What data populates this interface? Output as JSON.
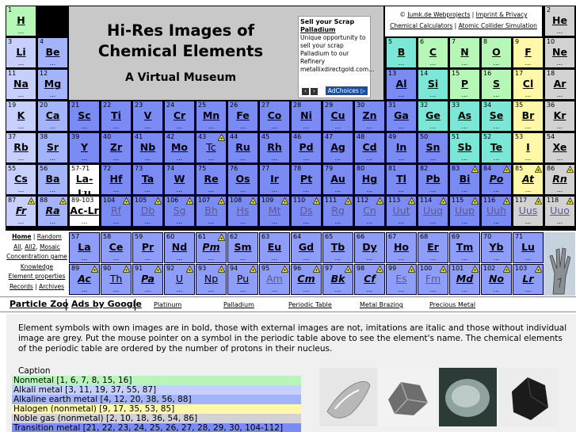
{
  "site": {
    "title_line1": "Hi-Res Images of",
    "title_line2": "Chemical Elements",
    "subtitle": "A Virtual Museum",
    "links": {
      "copyright": "©",
      "author": "Jumk.de Webprojects",
      "imprint": "Imprint & Privacy",
      "calculators": "Chemical Calculators",
      "collider": "Atomic Collider Simulation"
    }
  },
  "ad": {
    "heading": "Sell your Scrap",
    "link": "Palladium",
    "body": "Unique opportunity to sell your scrap Palladium to our Refinery",
    "url": "metallixdirectgold.com...",
    "adchoices": "AdChoices"
  },
  "menu": {
    "items": [
      "Home",
      "Random",
      "All",
      "All2",
      "Mosaic",
      "Concentration game",
      "Knowledge",
      "Element properties",
      "Records",
      "Archives"
    ]
  },
  "bottom_bar": {
    "particle_zoo": "Particle Zoo",
    "ads_by_google": "Ads by Google",
    "links": [
      "Platinum",
      "Palladium",
      "Periodic Table",
      "Metal Brazing",
      "Precious Metal"
    ]
  },
  "intro_text": "Element symbols with own images are in bold, those with external images are not, imitations are italic and those without individual image are grey. Put the mouse pointer on a symbol in the periodic table above to see the element's name. The chemical elements of the periodic table are ordered by the number of protons in their nucleus.",
  "caption_label": "Caption",
  "legend": [
    {
      "label": "Nonmetal [1, 6, 7, 8, 15, 16]",
      "color": "#b6f6b6"
    },
    {
      "label": "Alkali metal [3, 11, 19, 37, 55, 87]",
      "color": "#c7cffd"
    },
    {
      "label": "Alkaline earth metal [4, 12, 20, 38, 56, 88]",
      "color": "#a4b4fa"
    },
    {
      "label": "Halogen (nonmetal) [9, 17, 35, 53, 85]",
      "color": "#fff8a8"
    },
    {
      "label": "Noble gas (nonmetal) [2, 10, 18, 36, 54, 86]",
      "color": "#d2d2d2"
    },
    {
      "label": "Transition metal [21, 22, 23, 24, 25, 26, 27, 28, 29, 30, 104-112]",
      "color": "#7b8bf4"
    }
  ],
  "dots": "...",
  "elements": [
    {
      "n": "1",
      "s": "H",
      "c": "c-nonmetal",
      "r": 0,
      "col": 0,
      "st": "b"
    },
    {
      "n": "2",
      "s": "He",
      "c": "c-noble",
      "r": 0,
      "col": 17,
      "st": "b"
    },
    {
      "n": "3",
      "s": "Li",
      "c": "c-alkali",
      "r": 1,
      "col": 0,
      "st": "b"
    },
    {
      "n": "4",
      "s": "Be",
      "c": "c-alkaline",
      "r": 1,
      "col": 1,
      "st": "b"
    },
    {
      "n": "5",
      "s": "B",
      "c": "c-metalloid",
      "r": 1,
      "col": 12,
      "st": "b"
    },
    {
      "n": "6",
      "s": "C",
      "c": "c-nonmetal",
      "r": 1,
      "col": 13,
      "st": "b"
    },
    {
      "n": "7",
      "s": "N",
      "c": "c-nonmetal",
      "r": 1,
      "col": 14,
      "st": "b"
    },
    {
      "n": "8",
      "s": "O",
      "c": "c-nonmetal",
      "r": 1,
      "col": 15,
      "st": "b"
    },
    {
      "n": "9",
      "s": "F",
      "c": "c-halogen",
      "r": 1,
      "col": 16,
      "st": "b"
    },
    {
      "n": "10",
      "s": "Ne",
      "c": "c-noble",
      "r": 1,
      "col": 17,
      "st": "b"
    },
    {
      "n": "11",
      "s": "Na",
      "c": "c-alkali",
      "r": 2,
      "col": 0,
      "st": "b"
    },
    {
      "n": "12",
      "s": "Mg",
      "c": "c-alkaline",
      "r": 2,
      "col": 1,
      "st": "b"
    },
    {
      "n": "13",
      "s": "Al",
      "c": "c-post",
      "r": 2,
      "col": 12,
      "st": "b"
    },
    {
      "n": "14",
      "s": "Si",
      "c": "c-metalloid",
      "r": 2,
      "col": 13,
      "st": "b"
    },
    {
      "n": "15",
      "s": "P",
      "c": "c-nonmetal",
      "r": 2,
      "col": 14,
      "st": "b"
    },
    {
      "n": "16",
      "s": "S",
      "c": "c-nonmetal",
      "r": 2,
      "col": 15,
      "st": "b"
    },
    {
      "n": "17",
      "s": "Cl",
      "c": "c-halogen",
      "r": 2,
      "col": 16,
      "st": "b"
    },
    {
      "n": "18",
      "s": "Ar",
      "c": "c-noble",
      "r": 2,
      "col": 17,
      "st": "b"
    },
    {
      "n": "19",
      "s": "K",
      "c": "c-alkali",
      "r": 3,
      "col": 0,
      "st": "b"
    },
    {
      "n": "20",
      "s": "Ca",
      "c": "c-alkaline",
      "r": 3,
      "col": 1,
      "st": "b"
    },
    {
      "n": "21",
      "s": "Sc",
      "c": "c-trans",
      "r": 3,
      "col": 2,
      "st": "b"
    },
    {
      "n": "22",
      "s": "Ti",
      "c": "c-trans",
      "r": 3,
      "col": 3,
      "st": "b"
    },
    {
      "n": "23",
      "s": "V",
      "c": "c-trans",
      "r": 3,
      "col": 4,
      "st": "b"
    },
    {
      "n": "24",
      "s": "Cr",
      "c": "c-trans",
      "r": 3,
      "col": 5,
      "st": "b"
    },
    {
      "n": "25",
      "s": "Mn",
      "c": "c-trans",
      "r": 3,
      "col": 6,
      "st": "b"
    },
    {
      "n": "26",
      "s": "Fe",
      "c": "c-trans",
      "r": 3,
      "col": 7,
      "st": "b"
    },
    {
      "n": "27",
      "s": "Co",
      "c": "c-trans",
      "r": 3,
      "col": 8,
      "st": "b"
    },
    {
      "n": "28",
      "s": "Ni",
      "c": "c-trans",
      "r": 3,
      "col": 9,
      "st": "b"
    },
    {
      "n": "29",
      "s": "Cu",
      "c": "c-trans",
      "r": 3,
      "col": 10,
      "st": "b"
    },
    {
      "n": "30",
      "s": "Zn",
      "c": "c-trans",
      "r": 3,
      "col": 11,
      "st": "b"
    },
    {
      "n": "31",
      "s": "Ga",
      "c": "c-post",
      "r": 3,
      "col": 12,
      "st": "b"
    },
    {
      "n": "32",
      "s": "Ge",
      "c": "c-metalloid",
      "r": 3,
      "col": 13,
      "st": "b"
    },
    {
      "n": "33",
      "s": "As",
      "c": "c-metalloid",
      "r": 3,
      "col": 14,
      "st": "b"
    },
    {
      "n": "34",
      "s": "Se",
      "c": "c-metalloid",
      "r": 3,
      "col": 15,
      "st": "b"
    },
    {
      "n": "35",
      "s": "Br",
      "c": "c-halogen",
      "r": 3,
      "col": 16,
      "st": "b"
    },
    {
      "n": "36",
      "s": "Kr",
      "c": "c-noble",
      "r": 3,
      "col": 17,
      "st": "b"
    },
    {
      "n": "37",
      "s": "Rb",
      "c": "c-alkali",
      "r": 4,
      "col": 0,
      "st": "b"
    },
    {
      "n": "38",
      "s": "Sr",
      "c": "c-alkaline",
      "r": 4,
      "col": 1,
      "st": "b"
    },
    {
      "n": "39",
      "s": "Y",
      "c": "c-trans",
      "r": 4,
      "col": 2,
      "st": "b"
    },
    {
      "n": "40",
      "s": "Zr",
      "c": "c-trans",
      "r": 4,
      "col": 3,
      "st": "b"
    },
    {
      "n": "41",
      "s": "Nb",
      "c": "c-trans",
      "r": 4,
      "col": 4,
      "st": "b"
    },
    {
      "n": "42",
      "s": "Mo",
      "c": "c-trans",
      "r": 4,
      "col": 5,
      "st": "b"
    },
    {
      "n": "43",
      "s": "Tc",
      "c": "c-trans",
      "r": 4,
      "col": 6,
      "st": "p",
      "rad": 1
    },
    {
      "n": "44",
      "s": "Ru",
      "c": "c-trans",
      "r": 4,
      "col": 7,
      "st": "b"
    },
    {
      "n": "45",
      "s": "Rh",
      "c": "c-trans",
      "r": 4,
      "col": 8,
      "st": "b"
    },
    {
      "n": "46",
      "s": "Pd",
      "c": "c-trans",
      "r": 4,
      "col": 9,
      "st": "b"
    },
    {
      "n": "47",
      "s": "Ag",
      "c": "c-trans",
      "r": 4,
      "col": 10,
      "st": "b"
    },
    {
      "n": "48",
      "s": "Cd",
      "c": "c-trans",
      "r": 4,
      "col": 11,
      "st": "b"
    },
    {
      "n": "49",
      "s": "In",
      "c": "c-post",
      "r": 4,
      "col": 12,
      "st": "b"
    },
    {
      "n": "50",
      "s": "Sn",
      "c": "c-post",
      "r": 4,
      "col": 13,
      "st": "b"
    },
    {
      "n": "51",
      "s": "Sb",
      "c": "c-metalloid",
      "r": 4,
      "col": 14,
      "st": "b"
    },
    {
      "n": "52",
      "s": "Te",
      "c": "c-metalloid",
      "r": 4,
      "col": 15,
      "st": "b"
    },
    {
      "n": "53",
      "s": "I",
      "c": "c-halogen",
      "r": 4,
      "col": 16,
      "st": "b"
    },
    {
      "n": "54",
      "s": "Xe",
      "c": "c-noble",
      "r": 4,
      "col": 17,
      "st": "b"
    },
    {
      "n": "55",
      "s": "Cs",
      "c": "c-alkali",
      "r": 5,
      "col": 0,
      "st": "b"
    },
    {
      "n": "56",
      "s": "Ba",
      "c": "c-alkaline",
      "r": 5,
      "col": 1,
      "st": "b"
    },
    {
      "n": "57-71",
      "s": "La-Lu",
      "c": "c-white",
      "r": 5,
      "col": 2,
      "st": "b"
    },
    {
      "n": "72",
      "s": "Hf",
      "c": "c-trans",
      "r": 5,
      "col": 3,
      "st": "b"
    },
    {
      "n": "73",
      "s": "Ta",
      "c": "c-trans",
      "r": 5,
      "col": 4,
      "st": "b"
    },
    {
      "n": "74",
      "s": "W",
      "c": "c-trans",
      "r": 5,
      "col": 5,
      "st": "b"
    },
    {
      "n": "75",
      "s": "Re",
      "c": "c-trans",
      "r": 5,
      "col": 6,
      "st": "b"
    },
    {
      "n": "76",
      "s": "Os",
      "c": "c-trans",
      "r": 5,
      "col": 7,
      "st": "b"
    },
    {
      "n": "77",
      "s": "Ir",
      "c": "c-trans",
      "r": 5,
      "col": 8,
      "st": "b"
    },
    {
      "n": "78",
      "s": "Pt",
      "c": "c-trans",
      "r": 5,
      "col": 9,
      "st": "b"
    },
    {
      "n": "79",
      "s": "Au",
      "c": "c-trans",
      "r": 5,
      "col": 10,
      "st": "b"
    },
    {
      "n": "80",
      "s": "Hg",
      "c": "c-trans",
      "r": 5,
      "col": 11,
      "st": "b"
    },
    {
      "n": "81",
      "s": "Tl",
      "c": "c-post",
      "r": 5,
      "col": 12,
      "st": "b"
    },
    {
      "n": "82",
      "s": "Pb",
      "c": "c-post",
      "r": 5,
      "col": 13,
      "st": "b"
    },
    {
      "n": "83",
      "s": "Bi",
      "c": "c-post",
      "r": 5,
      "col": 14,
      "st": "b",
      "rad": 1
    },
    {
      "n": "84",
      "s": "Po",
      "c": "c-post",
      "r": 5,
      "col": 15,
      "st": "i",
      "rad": 1
    },
    {
      "n": "85",
      "s": "At",
      "c": "c-halogen",
      "r": 5,
      "col": 16,
      "st": "i",
      "rad": 1
    },
    {
      "n": "86",
      "s": "Rn",
      "c": "c-noble",
      "r": 5,
      "col": 17,
      "st": "i",
      "rad": 1
    },
    {
      "n": "87",
      "s": "Fr",
      "c": "c-alkali",
      "r": 6,
      "col": 0,
      "st": "i",
      "rad": 1
    },
    {
      "n": "88",
      "s": "Ra",
      "c": "c-alkaline",
      "r": 6,
      "col": 1,
      "st": "i",
      "rad": 1
    },
    {
      "n": "89-103",
      "s": "Ac-Lr",
      "c": "c-white",
      "r": 6,
      "col": 2,
      "st": "b"
    },
    {
      "n": "104",
      "s": "Rf",
      "c": "c-trans",
      "r": 6,
      "col": 3,
      "st": "g",
      "rad": 1
    },
    {
      "n": "105",
      "s": "Db",
      "c": "c-trans",
      "r": 6,
      "col": 4,
      "st": "g",
      "rad": 1
    },
    {
      "n": "106",
      "s": "Sg",
      "c": "c-trans",
      "r": 6,
      "col": 5,
      "st": "g",
      "rad": 1
    },
    {
      "n": "107",
      "s": "Bh",
      "c": "c-trans",
      "r": 6,
      "col": 6,
      "st": "g",
      "rad": 1
    },
    {
      "n": "108",
      "s": "Hs",
      "c": "c-trans",
      "r": 6,
      "col": 7,
      "st": "g",
      "rad": 1
    },
    {
      "n": "109",
      "s": "Mt",
      "c": "c-trans",
      "r": 6,
      "col": 8,
      "st": "g",
      "rad": 1
    },
    {
      "n": "110",
      "s": "Ds",
      "c": "c-trans",
      "r": 6,
      "col": 9,
      "st": "g",
      "rad": 1
    },
    {
      "n": "111",
      "s": "Rg",
      "c": "c-trans",
      "r": 6,
      "col": 10,
      "st": "g",
      "rad": 1
    },
    {
      "n": "112",
      "s": "Cn",
      "c": "c-trans",
      "r": 6,
      "col": 11,
      "st": "g",
      "rad": 1
    },
    {
      "n": "113",
      "s": "Uut",
      "c": "c-post",
      "r": 6,
      "col": 12,
      "st": "g",
      "rad": 1
    },
    {
      "n": "114",
      "s": "Uuq",
      "c": "c-post",
      "r": 6,
      "col": 13,
      "st": "g",
      "rad": 1
    },
    {
      "n": "115",
      "s": "Uup",
      "c": "c-post",
      "r": 6,
      "col": 14,
      "st": "g",
      "rad": 1
    },
    {
      "n": "116",
      "s": "Uuh",
      "c": "c-post",
      "r": 6,
      "col": 15,
      "st": "g",
      "rad": 1
    },
    {
      "n": "117",
      "s": "Uus",
      "c": "c-noble",
      "r": 6,
      "col": 16,
      "st": "g",
      "rad": 1
    },
    {
      "n": "118",
      "s": "Uuo",
      "c": "c-noble",
      "r": 6,
      "col": 17,
      "st": "g",
      "rad": 1
    },
    {
      "n": "57",
      "s": "La",
      "c": "c-lan",
      "r": 7,
      "col": 2,
      "st": "b"
    },
    {
      "n": "58",
      "s": "Ce",
      "c": "c-lan",
      "r": 7,
      "col": 3,
      "st": "b"
    },
    {
      "n": "59",
      "s": "Pr",
      "c": "c-lan",
      "r": 7,
      "col": 4,
      "st": "b"
    },
    {
      "n": "60",
      "s": "Nd",
      "c": "c-lan",
      "r": 7,
      "col": 5,
      "st": "b"
    },
    {
      "n": "61",
      "s": "Pm",
      "c": "c-lan",
      "r": 7,
      "col": 6,
      "st": "i",
      "rad": 1
    },
    {
      "n": "62",
      "s": "Sm",
      "c": "c-lan",
      "r": 7,
      "col": 7,
      "st": "b"
    },
    {
      "n": "63",
      "s": "Eu",
      "c": "c-lan",
      "r": 7,
      "col": 8,
      "st": "b"
    },
    {
      "n": "64",
      "s": "Gd",
      "c": "c-lan",
      "r": 7,
      "col": 9,
      "st": "b"
    },
    {
      "n": "65",
      "s": "Tb",
      "c": "c-lan",
      "r": 7,
      "col": 10,
      "st": "b"
    },
    {
      "n": "66",
      "s": "Dy",
      "c": "c-lan",
      "r": 7,
      "col": 11,
      "st": "b"
    },
    {
      "n": "67",
      "s": "Ho",
      "c": "c-lan",
      "r": 7,
      "col": 12,
      "st": "b"
    },
    {
      "n": "68",
      "s": "Er",
      "c": "c-lan",
      "r": 7,
      "col": 13,
      "st": "b"
    },
    {
      "n": "69",
      "s": "Tm",
      "c": "c-lan",
      "r": 7,
      "col": 14,
      "st": "b"
    },
    {
      "n": "70",
      "s": "Yb",
      "c": "c-lan",
      "r": 7,
      "col": 15,
      "st": "b"
    },
    {
      "n": "71",
      "s": "Lu",
      "c": "c-lan",
      "r": 7,
      "col": 16,
      "st": "b"
    },
    {
      "n": "89",
      "s": "Ac",
      "c": "c-lan",
      "r": 8,
      "col": 2,
      "st": "i",
      "rad": 1
    },
    {
      "n": "90",
      "s": "Th",
      "c": "c-lan",
      "r": 8,
      "col": 3,
      "st": "p",
      "rad": 1
    },
    {
      "n": "91",
      "s": "Pa",
      "c": "c-lan",
      "r": 8,
      "col": 4,
      "st": "i",
      "rad": 1
    },
    {
      "n": "92",
      "s": "U",
      "c": "c-lan",
      "r": 8,
      "col": 5,
      "st": "p",
      "rad": 1
    },
    {
      "n": "93",
      "s": "Np",
      "c": "c-lan",
      "r": 8,
      "col": 6,
      "st": "p",
      "rad": 1
    },
    {
      "n": "94",
      "s": "Pu",
      "c": "c-lan",
      "r": 8,
      "col": 7,
      "st": "p",
      "rad": 1
    },
    {
      "n": "95",
      "s": "Am",
      "c": "c-lan",
      "r": 8,
      "col": 8,
      "st": "g",
      "rad": 1
    },
    {
      "n": "96",
      "s": "Cm",
      "c": "c-lan",
      "r": 8,
      "col": 9,
      "st": "i",
      "rad": 1
    },
    {
      "n": "97",
      "s": "Bk",
      "c": "c-lan",
      "r": 8,
      "col": 10,
      "st": "i",
      "rad": 1
    },
    {
      "n": "98",
      "s": "Cf",
      "c": "c-lan",
      "r": 8,
      "col": 11,
      "st": "i",
      "rad": 1
    },
    {
      "n": "99",
      "s": "Es",
      "c": "c-lan",
      "r": 8,
      "col": 12,
      "st": "g",
      "rad": 1
    },
    {
      "n": "100",
      "s": "Fm",
      "c": "c-lan",
      "r": 8,
      "col": 13,
      "st": "g",
      "rad": 1
    },
    {
      "n": "101",
      "s": "Md",
      "c": "c-lan",
      "r": 8,
      "col": 14,
      "st": "i",
      "rad": 1
    },
    {
      "n": "102",
      "s": "No",
      "c": "c-lan",
      "r": 8,
      "col": 15,
      "st": "i",
      "rad": 1
    },
    {
      "n": "103",
      "s": "Lr",
      "c": "c-lan",
      "r": 8,
      "col": 16,
      "st": "i",
      "rad": 1
    }
  ]
}
